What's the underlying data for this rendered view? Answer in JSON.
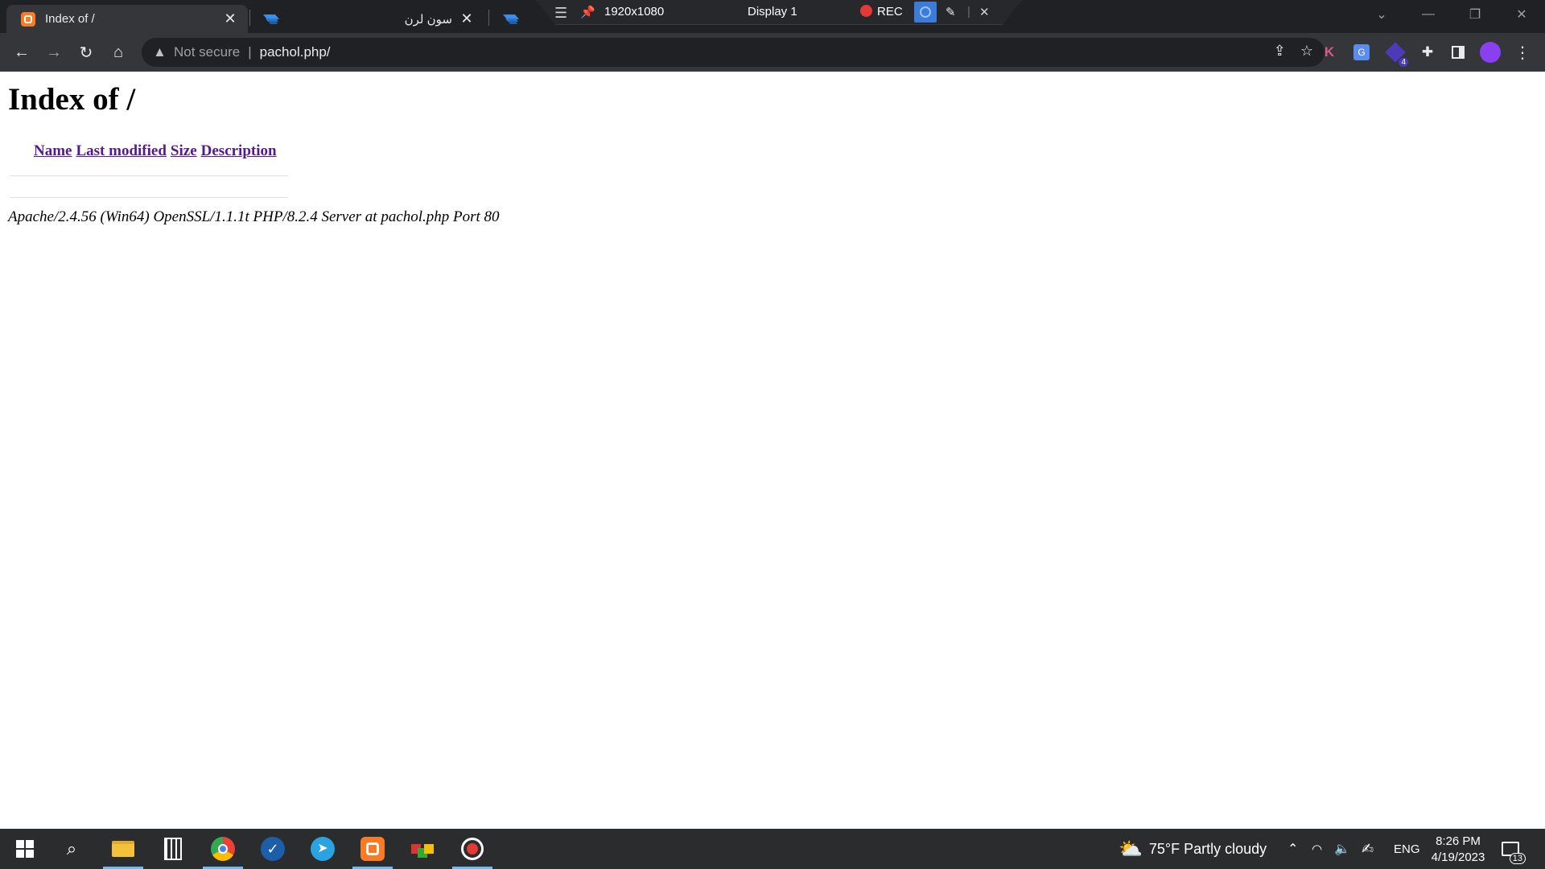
{
  "browser": {
    "tabs": [
      {
        "title": "Index of /",
        "active": true
      },
      {
        "title": "سون لرن",
        "active": false
      },
      {
        "title": "",
        "active": false
      }
    ],
    "recording_overlay": {
      "resolution": "1920x1080",
      "display": "Display 1",
      "rec_label": "REC"
    },
    "omnibox": {
      "security_text": "Not secure",
      "url": "pachol.php/"
    },
    "extensions": {
      "k_label": "K",
      "badge_count": "4"
    }
  },
  "page": {
    "heading": "Index of /",
    "columns": [
      "Name",
      "Last modified",
      "Size",
      "Description"
    ],
    "server_signature": "Apache/2.4.56 (Win64) OpenSSL/1.1.1t PHP/8.2.4 Server at pachol.php Port 80"
  },
  "taskbar": {
    "weather": "75°F  Partly cloudy",
    "language": "ENG",
    "time": "8:26 PM",
    "date": "4/19/2023",
    "notification_count": "13"
  },
  "colors": {
    "visited_link": "#551a8b",
    "tab_strip": "#202124",
    "toolbar": "#35363a",
    "taskbar": "#2a2c2e"
  }
}
